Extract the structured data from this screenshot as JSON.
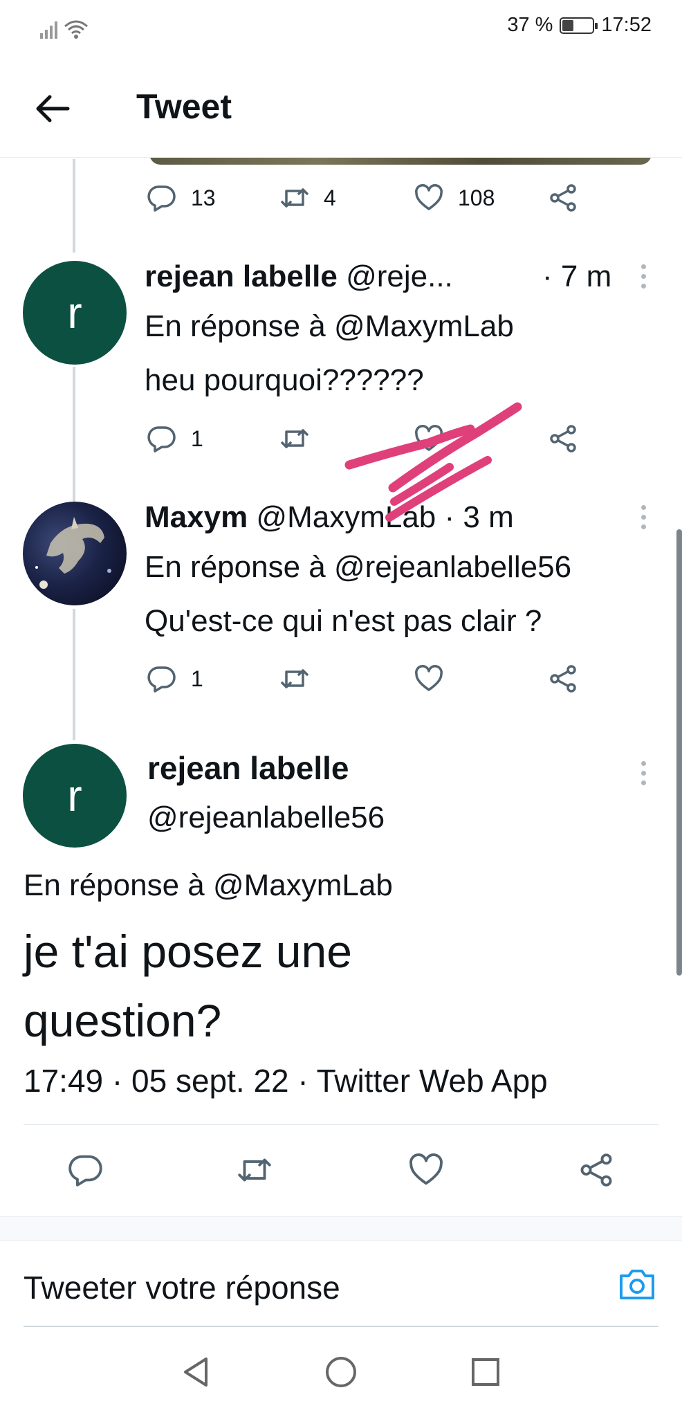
{
  "status_bar": {
    "battery_percent": "37 %",
    "clock": "17:52",
    "battery_level": 0.37
  },
  "header": {
    "title": "Tweet"
  },
  "parent_tweet_actions": {
    "replies": "13",
    "retweets": "4",
    "likes": "108"
  },
  "reply_1": {
    "avatar_letter": "r",
    "name": "rejean labelle",
    "handle": "@reje...",
    "time": "· 7 m",
    "reply_to": "En réponse à @MaxymLab",
    "text": "heu pourquoi??????",
    "replies": "1"
  },
  "reply_2": {
    "name": "Maxym",
    "handle": "@MaxymLab",
    "time": "· 3 m",
    "reply_to": "En réponse à @rejeanlabelle56",
    "text": "Qu'est-ce qui n'est pas clair ?",
    "replies": "1"
  },
  "focused_tweet": {
    "avatar_letter": "r",
    "name": "rejean labelle",
    "handle": "@rejeanlabelle56",
    "reply_to": "En réponse à @MaxymLab",
    "text_line1": "je t'ai posez une",
    "text_line2": "question?",
    "meta": "17:49 · 05 sept. 22 · Twitter Web App"
  },
  "reply_bar": {
    "placeholder": "Tweeter votre réponse"
  },
  "colors": {
    "avatar_green": "#0b5040",
    "icon_gray": "#536471",
    "camera_blue": "#1d9bf0",
    "scribble_pink": "#e0407a"
  },
  "icons": [
    "back-arrow-icon",
    "reply-icon",
    "retweet-icon",
    "like-icon",
    "share-icon",
    "camera-icon",
    "nav-back-icon",
    "nav-home-icon",
    "nav-recents-icon"
  ]
}
